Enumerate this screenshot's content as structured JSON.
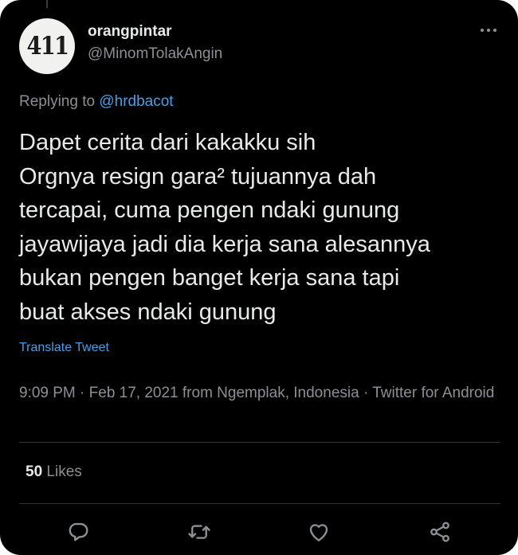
{
  "author": {
    "avatar_text": "411",
    "display_name": "orangpintar",
    "handle": "@MinomTolakAngin"
  },
  "reply": {
    "prefix": "Replying to ",
    "target": "@hrdbacot"
  },
  "tweet": {
    "text": "Dapet cerita dari kakakku sih\nOrgnya resign gara² tujuannya dah\ntercapai, cuma pengen ndaki gunung\njayawijaya jadi dia kerja sana alesannya\nbukan pengen banget kerja sana tapi\nbuat akses ndaki gunung",
    "translate_label": "Translate Tweet",
    "meta": "9:09 PM · Feb 17, 2021 from Ngemplak, Indonesia · Twitter for Android"
  },
  "stats": {
    "likes_count": "50",
    "likes_label": " Likes"
  },
  "icons": {
    "more": "more-dots-icon",
    "reply": "reply-bubble-icon",
    "retweet": "retweet-icon",
    "like": "heart-icon",
    "share": "share-icon"
  },
  "colors": {
    "background": "#000000",
    "link": "#4a9fe8",
    "secondary_text": "#8b9095",
    "primary_text": "#e7e9ea"
  }
}
